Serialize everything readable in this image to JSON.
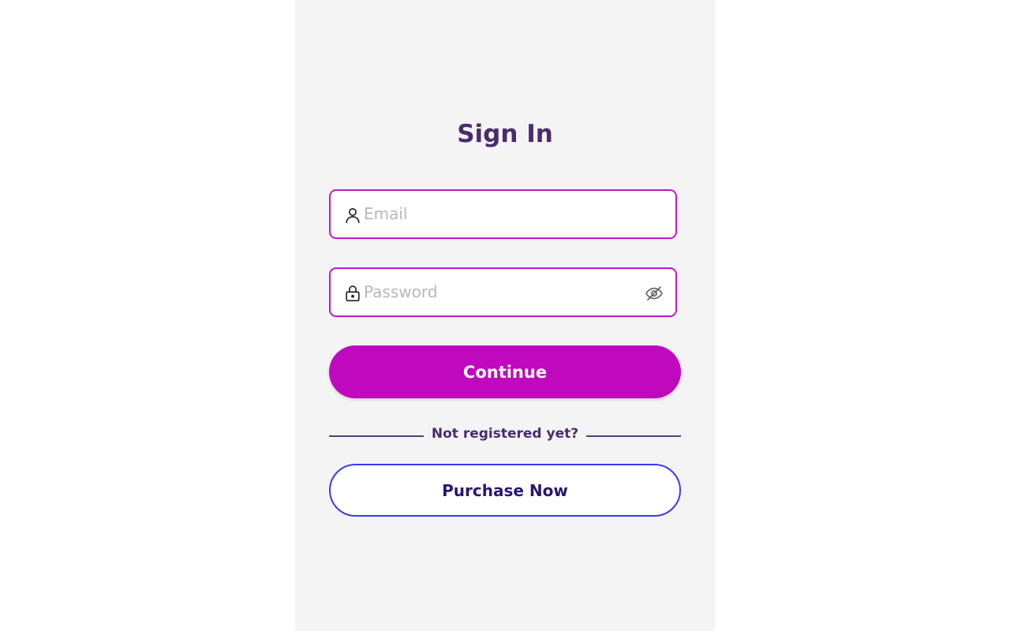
{
  "title": "Sign In",
  "email": {
    "placeholder": "Email",
    "icon": "user-icon"
  },
  "password": {
    "placeholder": "Password",
    "icon": "lock-icon",
    "toggle_icon": "eye-off-icon"
  },
  "continue_label": "Continue",
  "divider_text": "Not registered yet?",
  "purchase_label": "Purchase Now",
  "colors": {
    "accent": "#c008bf",
    "title": "#4a2c6e",
    "purchase_border": "#3b3bea",
    "purchase_text": "#2a1670",
    "panel_bg": "#f5f4f5"
  }
}
